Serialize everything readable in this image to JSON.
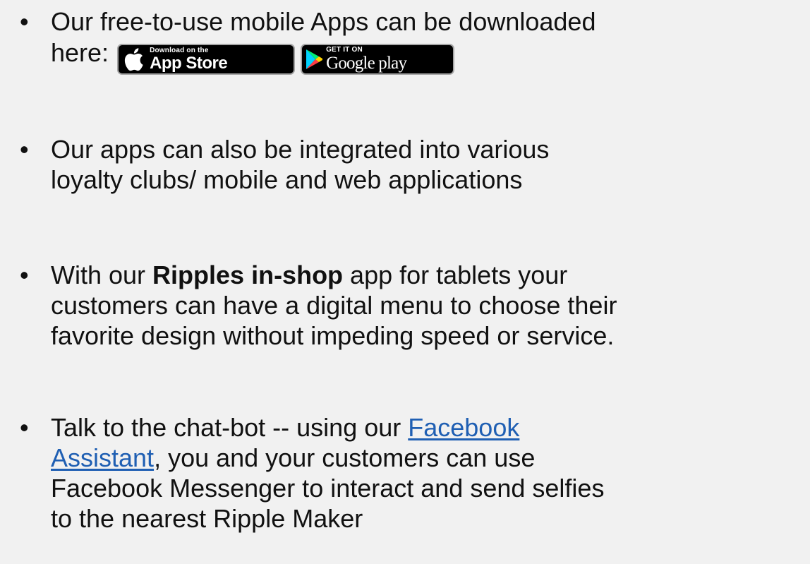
{
  "bullet_symbol": "•",
  "colors": {
    "background": "#f1f1f1",
    "text": "#111111",
    "link": "#1f5fb3",
    "badge_bg": "#000000",
    "badge_border": "#a6a6a6"
  },
  "bullets": [
    {
      "line1": "Our free-to-use mobile Apps can be downloaded",
      "line2_prefix": "here:",
      "badges": {
        "app_store": {
          "icon": "apple-icon",
          "small_text": "Download on the",
          "large_text": "App Store"
        },
        "google_play": {
          "icon": "google-play-icon",
          "small_text": "GET IT ON",
          "large_text": "Google play"
        }
      }
    },
    {
      "line1": "Our apps can also be integrated into various",
      "line2": "loyalty clubs/ mobile and web applications"
    },
    {
      "line1_before": "With our ",
      "line1_bold": "Ripples in-shop",
      "line1_after": " app for tablets your",
      "line2": "customers can have a digital menu to choose their",
      "line3": "favorite design without impeding speed or service."
    },
    {
      "line1_before": "Talk to the chat-bot -- using our ",
      "link_part1": "Facebook",
      "link_part2": "Assistant",
      "line2_after": ", you and your customers can use",
      "line3": "Facebook Messenger to interact and send selfies",
      "line4": "to the nearest Ripple Maker"
    }
  ]
}
